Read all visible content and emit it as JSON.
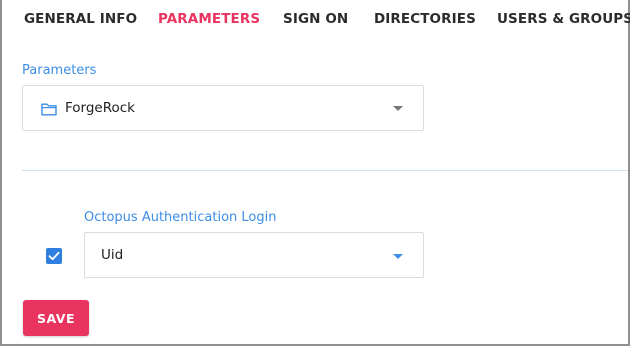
{
  "tabs": [
    {
      "label": "GENERAL INFO",
      "active": false
    },
    {
      "label": "PARAMETERS",
      "active": true
    },
    {
      "label": "SIGN ON",
      "active": false
    },
    {
      "label": "DIRECTORIES",
      "active": false
    },
    {
      "label": "USERS & GROUPS",
      "active": false
    }
  ],
  "parameters": {
    "label": "Parameters",
    "select_value": "ForgeRock",
    "value_icon": "folder-icon"
  },
  "auth_login": {
    "label": "Octopus Authentication Login",
    "checked": true,
    "select_value": "Uid"
  },
  "save_label": "SAVE",
  "colors": {
    "accent": "#e8345f",
    "link": "#3d8ee6",
    "checkbox": "#2f7fe0",
    "caret_gray": "#777777"
  }
}
